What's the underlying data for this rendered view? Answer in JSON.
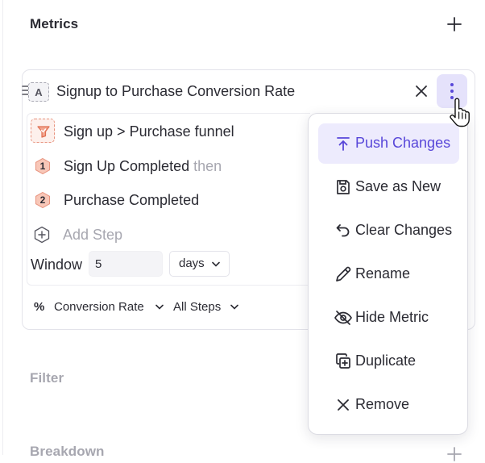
{
  "sections": {
    "metrics_title": "Metrics",
    "filter_title": "Filter",
    "breakdown_title": "Breakdown"
  },
  "metric": {
    "letter": "A",
    "title": "Signup to Purchase Conversion Rate",
    "funnel_name": "Sign up > Purchase funnel",
    "steps": [
      {
        "number": "1",
        "event": "Sign Up Completed",
        "suffix": "then"
      },
      {
        "number": "2",
        "event": "Purchase Completed",
        "suffix": ""
      }
    ],
    "add_step_label": "Add Step",
    "window_label": "Window",
    "window_value": "5",
    "window_unit": "days",
    "measure_symbol": "%",
    "measure_label": "Conversion Rate",
    "steps_scope": "All Steps"
  },
  "menu": {
    "items": [
      {
        "label": "Push Changes",
        "icon": "push-changes-icon"
      },
      {
        "label": "Save as New",
        "icon": "save-as-new-icon"
      },
      {
        "label": "Clear Changes",
        "icon": "undo-icon"
      },
      {
        "label": "Rename",
        "icon": "pencil-icon"
      },
      {
        "label": "Hide Metric",
        "icon": "eye-off-icon"
      },
      {
        "label": "Duplicate",
        "icon": "duplicate-icon"
      },
      {
        "label": "Remove",
        "icon": "close-icon"
      }
    ]
  },
  "colors": {
    "accent": "#5847d9",
    "accent_bg": "#edebfd",
    "step_badge": "#f6b9a8",
    "muted_text": "#a7a7b0"
  }
}
